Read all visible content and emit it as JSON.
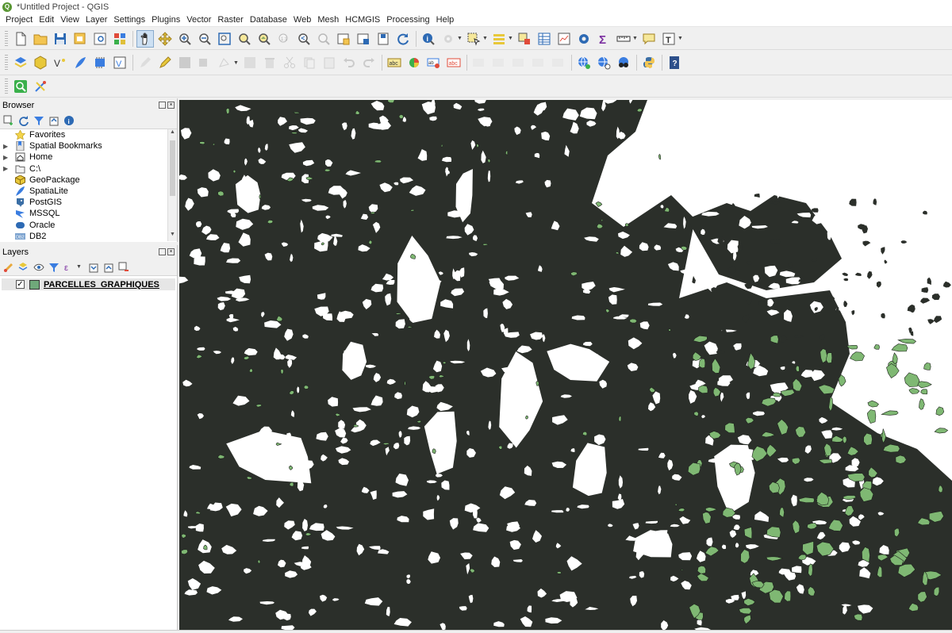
{
  "window": {
    "title": "*Untitled Project - QGIS",
    "logo": "qgis-logo"
  },
  "menu": [
    "Project",
    "Edit",
    "View",
    "Layer",
    "Settings",
    "Plugins",
    "Vector",
    "Raster",
    "Database",
    "Web",
    "Mesh",
    "HCMGIS",
    "Processing",
    "Help"
  ],
  "browser": {
    "title": "Browser",
    "items": [
      {
        "label": "Favorites",
        "icon": "star-icon",
        "expandable": false
      },
      {
        "label": "Spatial Bookmarks",
        "icon": "bookmark-icon",
        "expandable": true
      },
      {
        "label": "Home",
        "icon": "home-folder-icon",
        "expandable": true
      },
      {
        "label": "C:\\",
        "icon": "drive-folder-icon",
        "expandable": true
      },
      {
        "label": "GeoPackage",
        "icon": "geopackage-icon",
        "expandable": false
      },
      {
        "label": "SpatiaLite",
        "icon": "spatialite-icon",
        "expandable": false
      },
      {
        "label": "PostGIS",
        "icon": "postgis-icon",
        "expandable": false
      },
      {
        "label": "MSSQL",
        "icon": "mssql-icon",
        "expandable": false
      },
      {
        "label": "Oracle",
        "icon": "oracle-icon",
        "expandable": false
      },
      {
        "label": "DB2",
        "icon": "db2-icon",
        "expandable": false
      }
    ]
  },
  "layers": {
    "title": "Layers",
    "items": [
      {
        "label": "PARCELLES_GRAPHIQUES",
        "checked": true,
        "swatch_color": "#6fa87a",
        "check_mark": "✓"
      }
    ]
  },
  "map": {
    "background": "#ffffff",
    "dark_fill": "#2b2f2a",
    "green_fill": "#7fb873"
  },
  "colors": {
    "accent": "#589632",
    "panel_bg": "#f0f0f0"
  }
}
